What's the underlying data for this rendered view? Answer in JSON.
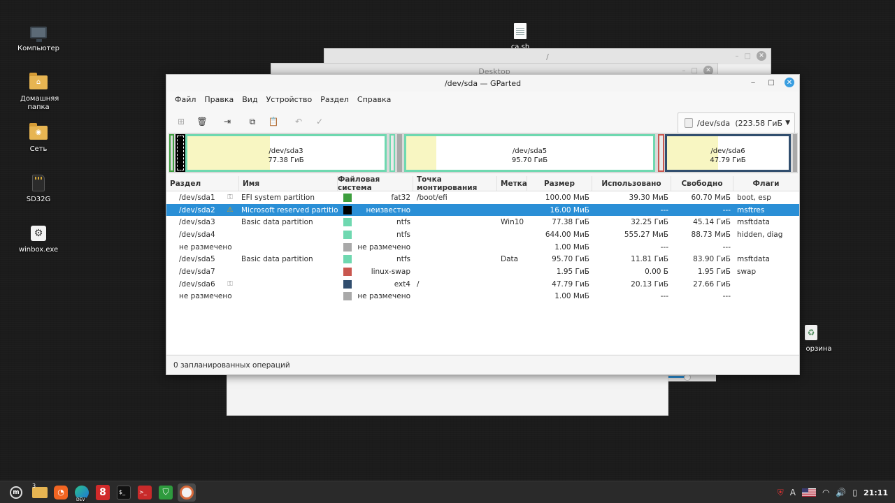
{
  "desktop": {
    "icons": [
      {
        "label": "Компьютер",
        "icon": "computer-icon"
      },
      {
        "label": "Домашняя папка",
        "icon": "home-folder-icon"
      },
      {
        "label": "Сеть",
        "icon": "network-folder-icon"
      },
      {
        "label": "SD32G",
        "icon": "sd-card-icon"
      },
      {
        "label": "winbox.exe",
        "icon": "executable-icon"
      },
      {
        "label": "ca.sh",
        "icon": "script-file-icon"
      },
      {
        "label": "орзина",
        "icon": "trash-icon"
      }
    ],
    "bg_windows": {
      "root_title": "/",
      "desktop_title": "Desktop"
    }
  },
  "window": {
    "title": "/dev/sda — GParted",
    "menu": [
      "Файл",
      "Правка",
      "Вид",
      "Устройство",
      "Раздел",
      "Справка"
    ],
    "device": {
      "name": "/dev/sda",
      "size": "(223.58 ГиБ"
    },
    "status": "0 запланированных операций"
  },
  "partition_map": [
    {
      "name": "/dev/sda3",
      "size": "77.38 ГиБ"
    },
    {
      "name": "/dev/sda5",
      "size": "95.70 ГиБ"
    },
    {
      "name": "/dev/sda6",
      "size": "47.79 ГиБ"
    }
  ],
  "table": {
    "headers": [
      "Раздел",
      "Имя",
      "Файловая система",
      "Точка монтирования",
      "Метка",
      "Размер",
      "Использовано",
      "Свободно",
      "Флаги"
    ],
    "rows": [
      {
        "part": "/dev/sda1",
        "icon": "key",
        "name": "EFI system partition",
        "fs": "fat32",
        "color": "#3d9e3d",
        "mount": "/boot/efi",
        "label": "",
        "size": "100.00 МиБ",
        "used": "39.30 МиБ",
        "free": "60.70 МиБ",
        "flags": "boot, esp"
      },
      {
        "part": "/dev/sda2",
        "icon": "warning",
        "name": "Microsoft reserved partition",
        "fs": "неизвестно",
        "color": "#000000",
        "mount": "",
        "label": "",
        "size": "16.00 МиБ",
        "used": "---",
        "free": "---",
        "flags": "msftres"
      },
      {
        "part": "/dev/sda3",
        "icon": "",
        "name": "Basic data partition",
        "fs": "ntfs",
        "color": "#6fd8b0",
        "mount": "",
        "label": "Win10",
        "size": "77.38 ГиБ",
        "used": "32.25 ГиБ",
        "free": "45.14 ГиБ",
        "flags": "msftdata"
      },
      {
        "part": "/dev/sda4",
        "icon": "",
        "name": "",
        "fs": "ntfs",
        "color": "#6fd8b0",
        "mount": "",
        "label": "",
        "size": "644.00 МиБ",
        "used": "555.27 МиБ",
        "free": "88.73 МиБ",
        "flags": "hidden, diag"
      },
      {
        "part": "не размечено",
        "icon": "",
        "name": "",
        "fs": "не размечено",
        "color": "#a9a9a9",
        "mount": "",
        "label": "",
        "size": "1.00 МиБ",
        "used": "---",
        "free": "---",
        "flags": ""
      },
      {
        "part": "/dev/sda5",
        "icon": "",
        "name": "Basic data partition",
        "fs": "ntfs",
        "color": "#6fd8b0",
        "mount": "",
        "label": "Data",
        "size": "95.70 ГиБ",
        "used": "11.81 ГиБ",
        "free": "83.90 ГиБ",
        "flags": "msftdata"
      },
      {
        "part": "/dev/sda7",
        "icon": "",
        "name": "",
        "fs": "linux-swap",
        "color": "#c9574f",
        "mount": "",
        "label": "",
        "size": "1.95 ГиБ",
        "used": "0.00 Б",
        "free": "1.95 ГиБ",
        "flags": "swap"
      },
      {
        "part": "/dev/sda6",
        "icon": "key",
        "name": "",
        "fs": "ext4",
        "color": "#314e6e",
        "mount": "/",
        "label": "",
        "size": "47.79 ГиБ",
        "used": "20.13 ГиБ",
        "free": "27.66 ГиБ",
        "flags": ""
      },
      {
        "part": "не размечено",
        "icon": "",
        "name": "",
        "fs": "не размечено",
        "color": "#a9a9a9",
        "mount": "",
        "label": "",
        "size": "1.00 МиБ",
        "used": "---",
        "free": "---",
        "flags": ""
      }
    ]
  },
  "taskbar": {
    "items": [
      "mint-menu-icon",
      "files-icon",
      "firefox-icon",
      "edge-dev-icon",
      "app-8-icon",
      "terminal-icon",
      "red-terminal-icon",
      "shield-icon",
      "gparted-icon"
    ],
    "files_badge": "3",
    "edge_badge": "DEV",
    "clock": "21:11"
  }
}
